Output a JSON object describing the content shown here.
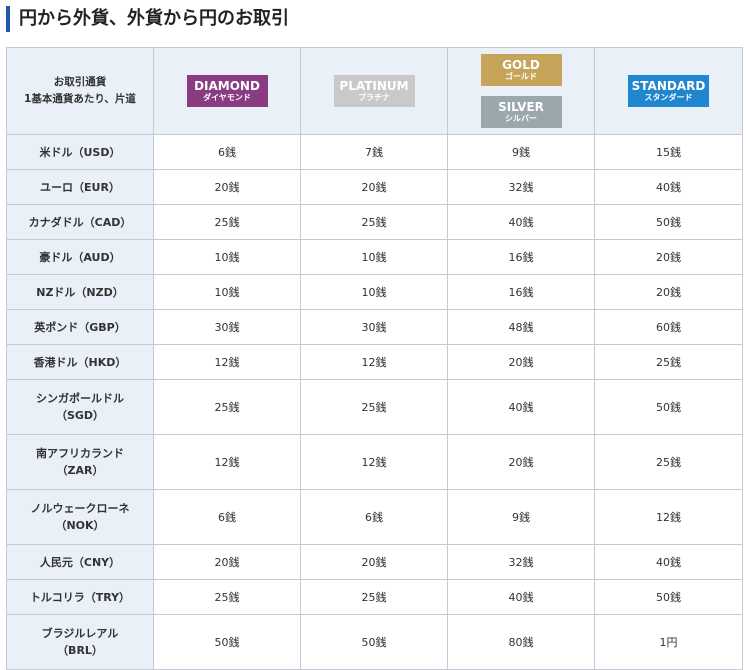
{
  "title": "円から外貨、外貨から円のお取引",
  "header": {
    "corner_line1": "お取引通貨",
    "corner_line2": "1基本通貨あたり、片道",
    "tiers": {
      "diamond": {
        "label": "DIAMOND",
        "sub": "ダイヤモンド",
        "color": "#8a3c82"
      },
      "platinum": {
        "label": "PLATINUM",
        "sub": "プラチナ",
        "color": "#c9c9c9"
      },
      "gold": {
        "label": "GOLD",
        "sub": "ゴールド",
        "color": "#c6a55b"
      },
      "silver": {
        "label": "SILVER",
        "sub": "シルバー",
        "color": "#9aa7ad"
      },
      "standard": {
        "label": "STANDARD",
        "sub": "スタンダード",
        "color": "#1f86cf"
      }
    }
  },
  "rows": [
    {
      "currency": [
        "米ドル（USD）"
      ],
      "fees": [
        "6銭",
        "7銭",
        "9銭",
        "15銭"
      ]
    },
    {
      "currency": [
        "ユーロ（EUR）"
      ],
      "fees": [
        "20銭",
        "20銭",
        "32銭",
        "40銭"
      ]
    },
    {
      "currency": [
        "カナダドル（CAD）"
      ],
      "fees": [
        "25銭",
        "25銭",
        "40銭",
        "50銭"
      ]
    },
    {
      "currency": [
        "豪ドル（AUD）"
      ],
      "fees": [
        "10銭",
        "10銭",
        "16銭",
        "20銭"
      ]
    },
    {
      "currency": [
        "NZドル（NZD）"
      ],
      "fees": [
        "10銭",
        "10銭",
        "16銭",
        "20銭"
      ]
    },
    {
      "currency": [
        "英ポンド（GBP）"
      ],
      "fees": [
        "30銭",
        "30銭",
        "48銭",
        "60銭"
      ]
    },
    {
      "currency": [
        "香港ドル（HKD）"
      ],
      "fees": [
        "12銭",
        "12銭",
        "20銭",
        "25銭"
      ]
    },
    {
      "currency": [
        "シンガポールドル",
        "（SGD）"
      ],
      "fees": [
        "25銭",
        "25銭",
        "40銭",
        "50銭"
      ]
    },
    {
      "currency": [
        "南アフリカランド",
        "（ZAR）"
      ],
      "fees": [
        "12銭",
        "12銭",
        "20銭",
        "25銭"
      ]
    },
    {
      "currency": [
        "ノルウェークローネ",
        "（NOK）"
      ],
      "fees": [
        "6銭",
        "6銭",
        "9銭",
        "12銭"
      ]
    },
    {
      "currency": [
        "人民元（CNY）"
      ],
      "fees": [
        "20銭",
        "20銭",
        "32銭",
        "40銭"
      ]
    },
    {
      "currency": [
        "トルコリラ（TRY）"
      ],
      "fees": [
        "25銭",
        "25銭",
        "40銭",
        "50銭"
      ]
    },
    {
      "currency": [
        "ブラジルレアル",
        "（BRL）"
      ],
      "fees": [
        "50銭",
        "50銭",
        "80銭",
        "1円"
      ]
    }
  ]
}
